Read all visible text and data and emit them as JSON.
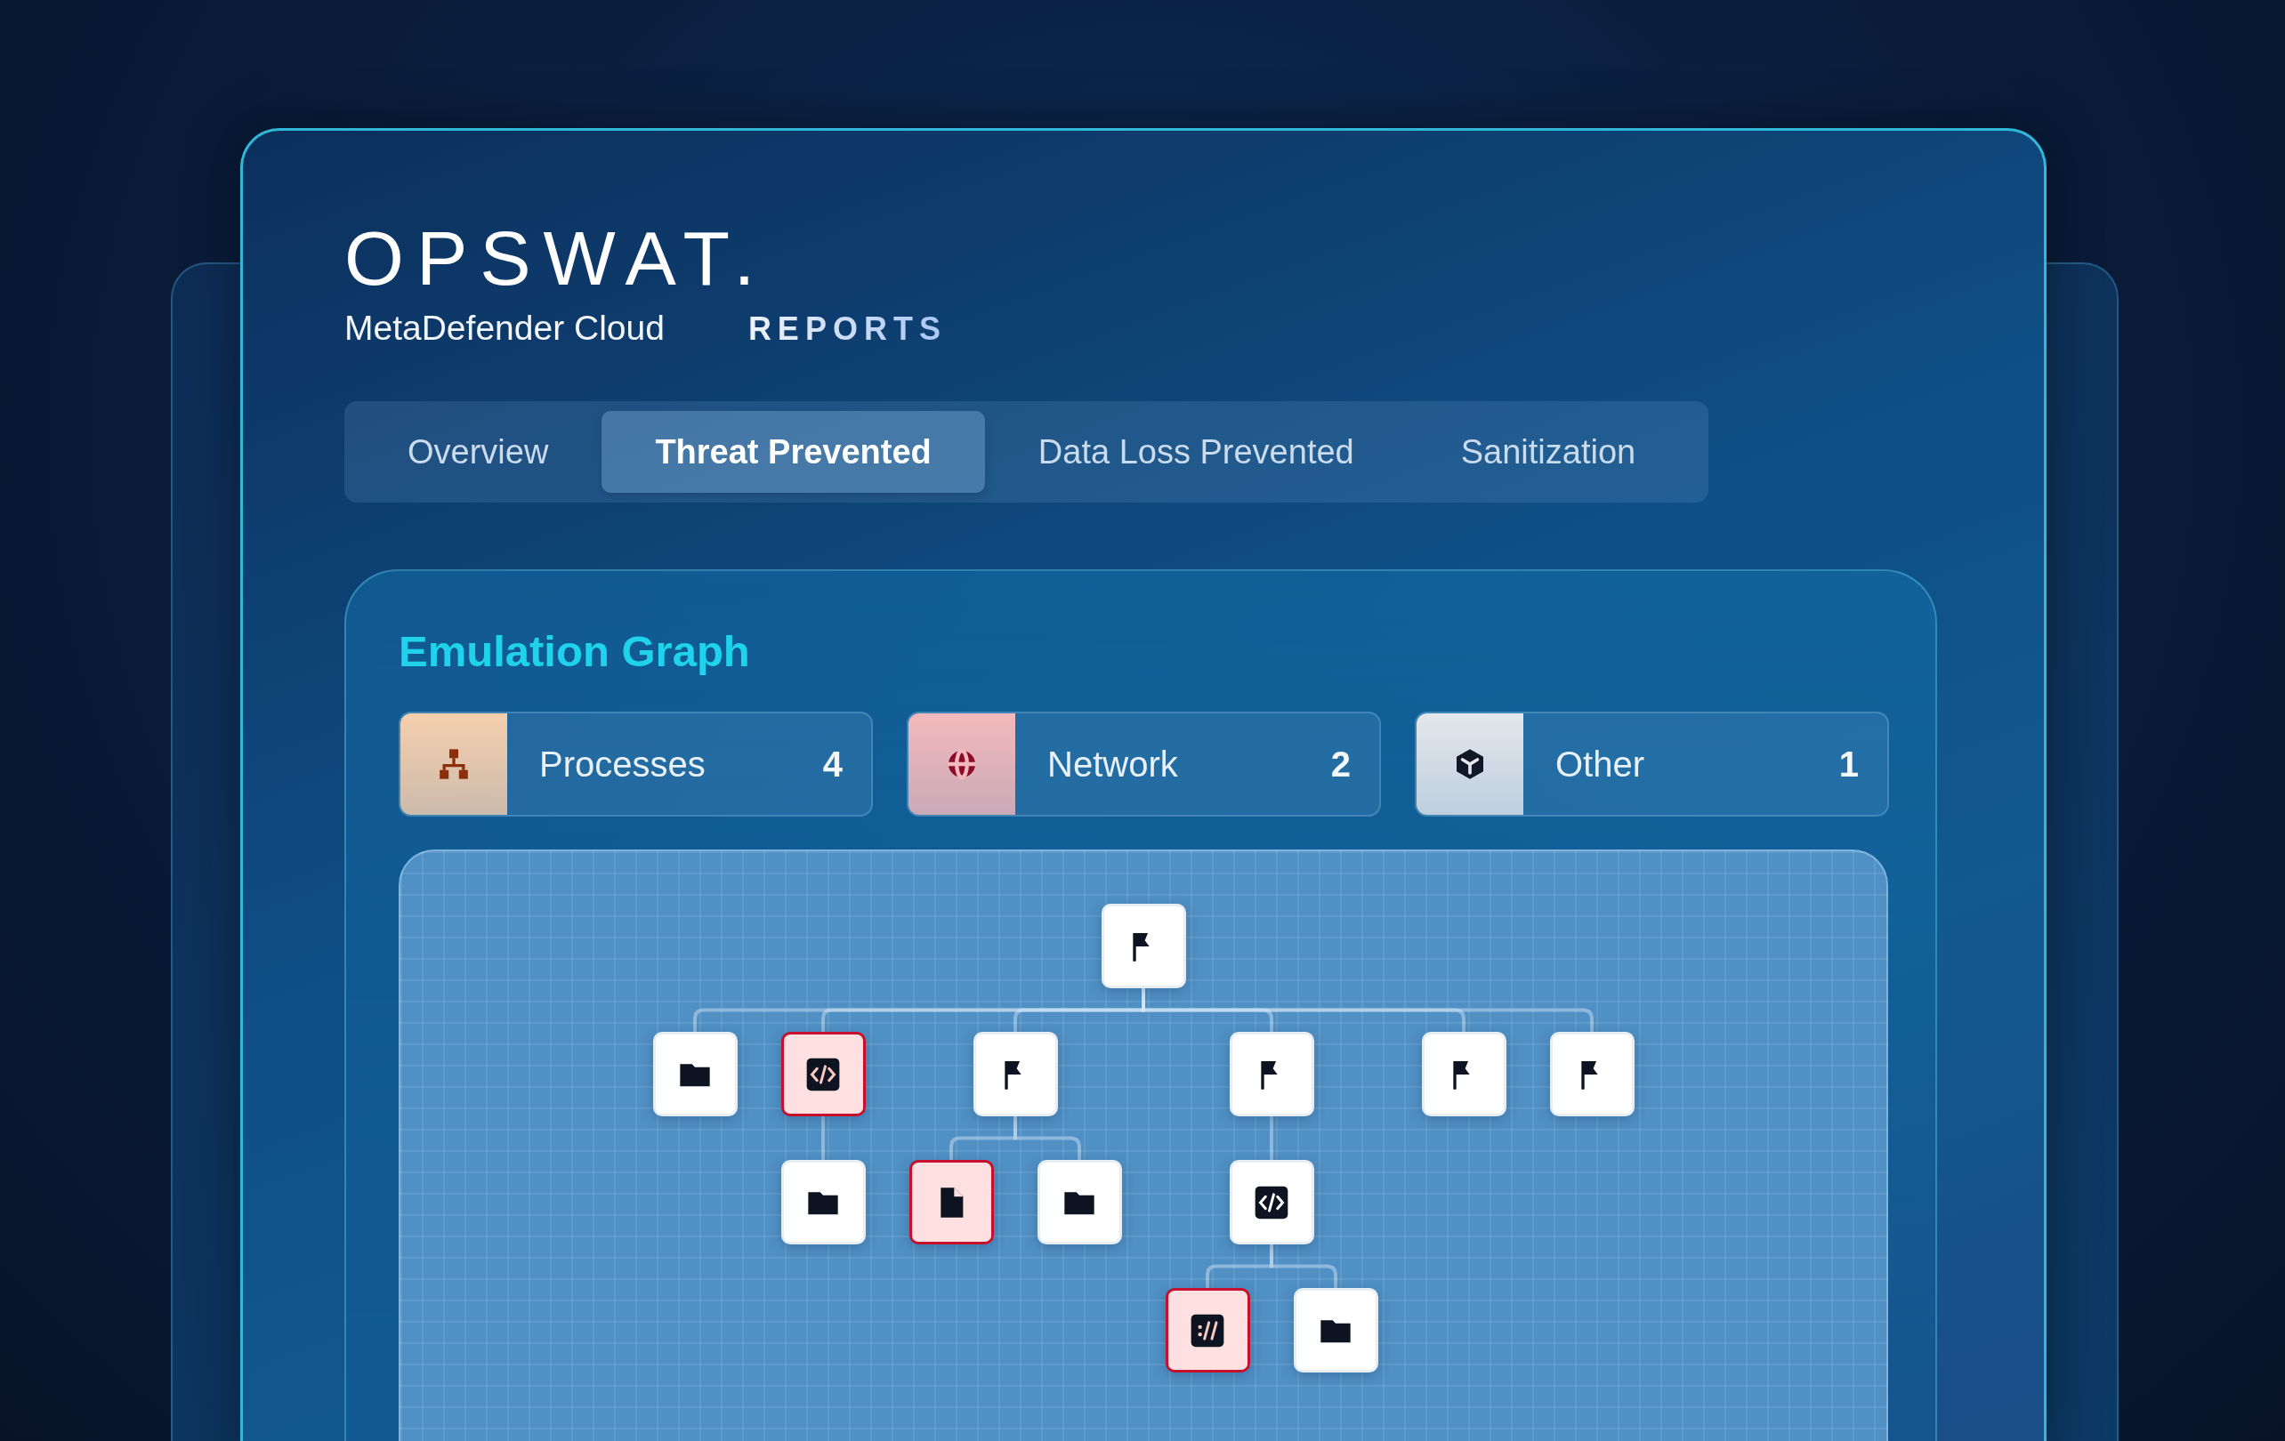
{
  "brand": {
    "logo": "OPSWAT.",
    "product": "MetaDefender Cloud",
    "section": "REPORTS"
  },
  "tabs": [
    {
      "label": "Overview",
      "selected": false
    },
    {
      "label": "Threat Prevented",
      "selected": true
    },
    {
      "label": "Data Loss Prevented",
      "selected": false
    },
    {
      "label": "Sanitization",
      "selected": false
    }
  ],
  "panel": {
    "title": "Emulation Graph",
    "stats": [
      {
        "kind": "processes",
        "label": "Processes",
        "count": "4",
        "color": "#f6cfae"
      },
      {
        "kind": "network",
        "label": "Network",
        "count": "2",
        "color": "#f4b9bc"
      },
      {
        "kind": "other",
        "label": "Other",
        "count": "1",
        "color": "#e4e7ec"
      }
    ],
    "graph": {
      "kind": "flag",
      "flagged": false,
      "children": [
        {
          "kind": "folder",
          "flagged": false
        },
        {
          "kind": "code",
          "flagged": true,
          "children": [
            {
              "kind": "folder",
              "flagged": false
            }
          ]
        },
        {
          "kind": "flag",
          "flagged": false,
          "children": [
            {
              "kind": "file",
              "flagged": true
            },
            {
              "kind": "folder",
              "flagged": false
            }
          ]
        },
        {
          "kind": "flag",
          "flagged": false,
          "children": [
            {
              "kind": "code",
              "flagged": false,
              "children": [
                {
                  "kind": "script",
                  "flagged": true
                },
                {
                  "kind": "folder",
                  "flagged": false
                }
              ]
            }
          ]
        },
        {
          "kind": "flag",
          "flagged": false
        },
        {
          "kind": "flag",
          "flagged": false
        }
      ]
    }
  }
}
